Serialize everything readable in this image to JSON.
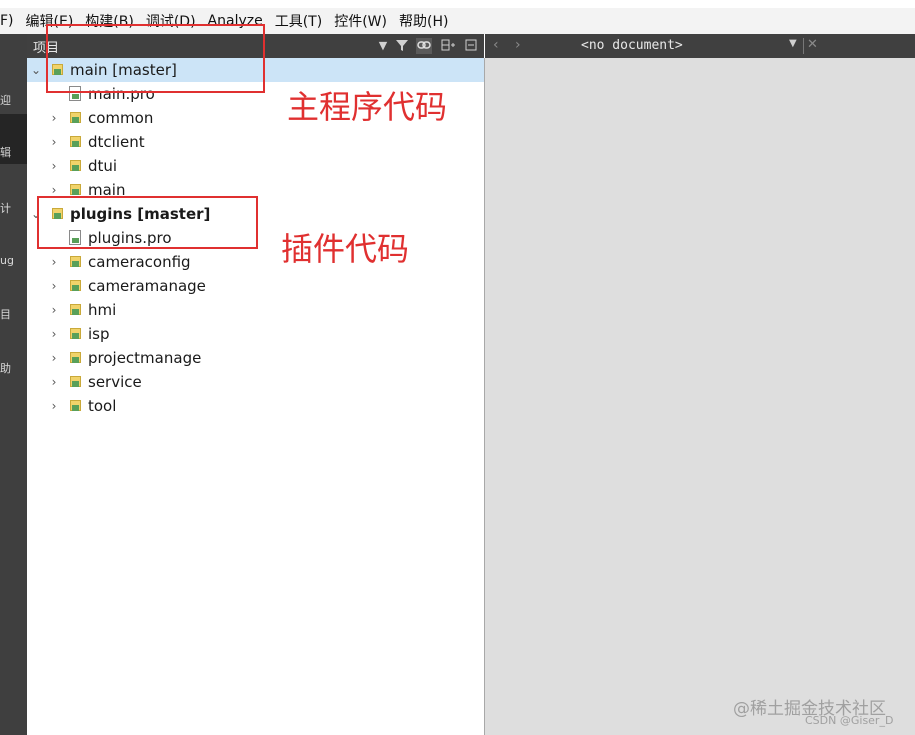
{
  "menubar": {
    "items": [
      "F)",
      "编辑(E)",
      "构建(B)",
      "调试(D)",
      "Analyze",
      "工具(T)",
      "控件(W)",
      "帮助(H)"
    ]
  },
  "modebar": {
    "modes": [
      "迎",
      "辑",
      "计",
      "ug",
      "目",
      "助"
    ]
  },
  "project_panel": {
    "title": "项目",
    "tree": [
      {
        "label": "main [master]",
        "kind": "project",
        "expanded": true,
        "selected": true,
        "bold": false
      },
      {
        "label": "main.pro",
        "kind": "file"
      },
      {
        "label": "common",
        "kind": "folder"
      },
      {
        "label": "dtclient",
        "kind": "folder"
      },
      {
        "label": "dtui",
        "kind": "folder"
      },
      {
        "label": "main",
        "kind": "folder"
      },
      {
        "label": "plugins [master]",
        "kind": "project",
        "expanded": true,
        "bold": true
      },
      {
        "label": "plugins.pro",
        "kind": "file"
      },
      {
        "label": "cameraconfig",
        "kind": "folder"
      },
      {
        "label": "cameramanage",
        "kind": "folder"
      },
      {
        "label": "hmi",
        "kind": "folder"
      },
      {
        "label": "isp",
        "kind": "folder"
      },
      {
        "label": "projectmanage",
        "kind": "folder"
      },
      {
        "label": "service",
        "kind": "folder"
      },
      {
        "label": "tool",
        "kind": "folder"
      }
    ]
  },
  "editor": {
    "document_title": "<no document>"
  },
  "annotations": {
    "main_code": "主程序代码",
    "plugin_code": "插件代码",
    "color": "#e03030"
  },
  "watermark": {
    "line1": "@稀土掘金技术社区",
    "line2": "CSDN @Giser_D"
  }
}
